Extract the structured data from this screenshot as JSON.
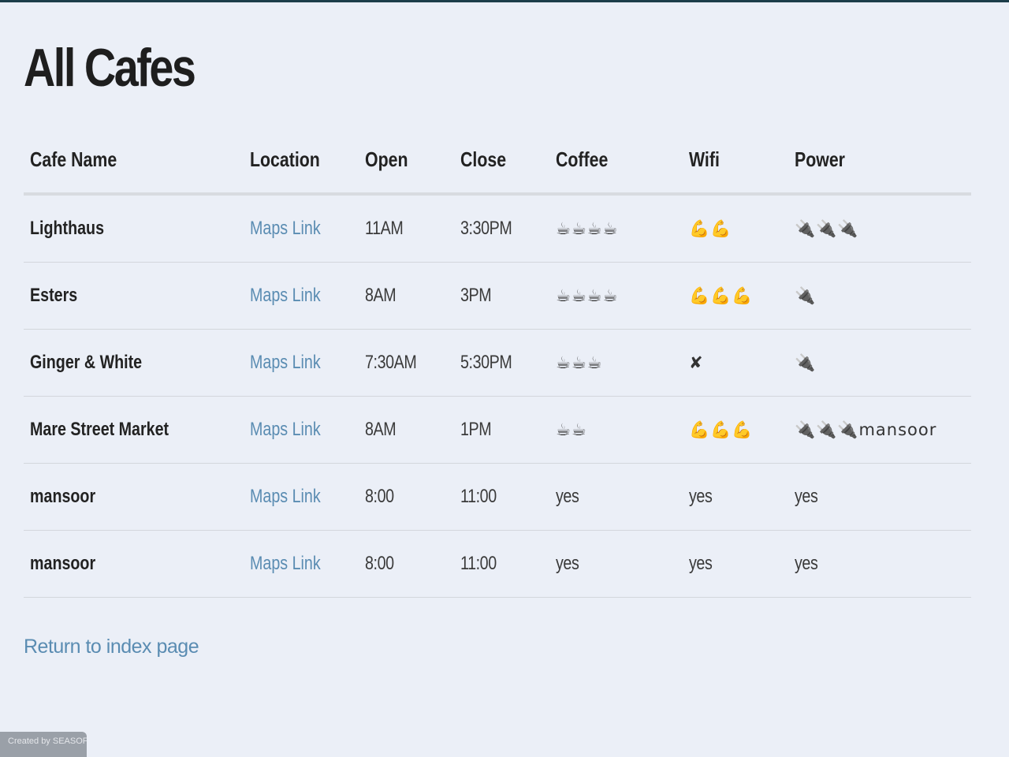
{
  "page": {
    "title": "All Cafes",
    "return_link": "Return to index page",
    "footer": "Created by SEASOFT LTD."
  },
  "table": {
    "headers": {
      "name": "Cafe Name",
      "location": "Location",
      "open": "Open",
      "close": "Close",
      "coffee": "Coffee",
      "wifi": "Wifi",
      "power": "Power"
    },
    "rows": [
      {
        "name": "Lighthaus",
        "location": "Maps Link",
        "open": "11AM",
        "close": "3:30PM",
        "coffee": "☕☕☕☕",
        "wifi": "💪💪",
        "power": "🔌🔌🔌"
      },
      {
        "name": "Esters",
        "location": "Maps Link",
        "open": "8AM",
        "close": "3PM",
        "coffee": "☕☕☕☕",
        "wifi": "💪💪💪",
        "power": "🔌"
      },
      {
        "name": "Ginger & White",
        "location": "Maps Link",
        "open": "7:30AM",
        "close": "5:30PM",
        "coffee": "☕☕☕",
        "wifi": "✘",
        "power": "🔌"
      },
      {
        "name": "Mare Street Market",
        "location": "Maps Link",
        "open": "8AM",
        "close": "1PM",
        "coffee": "☕☕",
        "wifi": "💪💪💪",
        "power": "🔌🔌🔌mansoor"
      },
      {
        "name": "mansoor",
        "location": "Maps Link",
        "open": "8:00",
        "close": "11:00",
        "coffee": "yes",
        "wifi": "yes",
        "power": "yes"
      },
      {
        "name": "mansoor",
        "location": "Maps Link",
        "open": "8:00",
        "close": "11:00",
        "coffee": "yes",
        "wifi": "yes",
        "power": "yes"
      }
    ]
  },
  "colors": {
    "background": "#ebeff7",
    "link": "#5a8cb2",
    "top_bar": "#1c3d4a"
  }
}
